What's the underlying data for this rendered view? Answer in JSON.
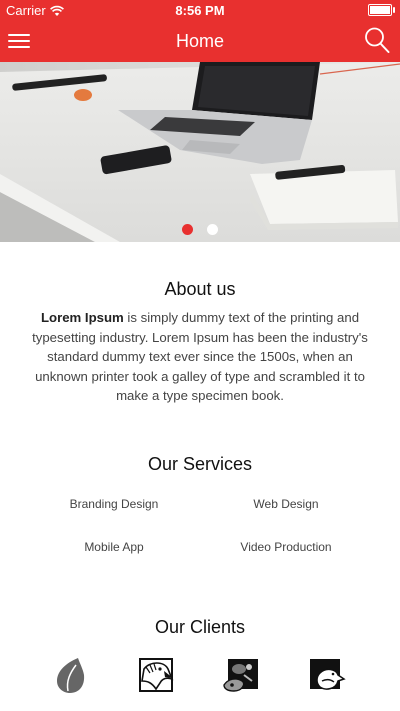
{
  "status_bar": {
    "carrier": "Carrier",
    "time": "8:56 PM",
    "battery_level": 1.0
  },
  "nav": {
    "title": "Home",
    "menu_icon": "hamburger-menu-icon",
    "search_icon": "search-icon"
  },
  "hero": {
    "slide_count": 2,
    "active_slide": 1
  },
  "about": {
    "title": "About us",
    "lead": "Lorem Ipsum",
    "body": " is simply dummy text of the printing and typesetting industry. Lorem Ipsum has been the industry's standard dummy text ever since the 1500s, when an unknown printer took a galley of type and scrambled it to make a type specimen book."
  },
  "services": {
    "title": "Our Services",
    "items": [
      "Branding Design",
      "Web Design",
      "Mobile App",
      "Video Production"
    ]
  },
  "clients": {
    "title": "Our Clients",
    "logos": [
      "drop-logo-icon",
      "eagle-logo-icon",
      "dog-logo-icon",
      "bird-logo-icon"
    ]
  },
  "colors": {
    "accent": "#e8302f",
    "text": "#444444"
  }
}
